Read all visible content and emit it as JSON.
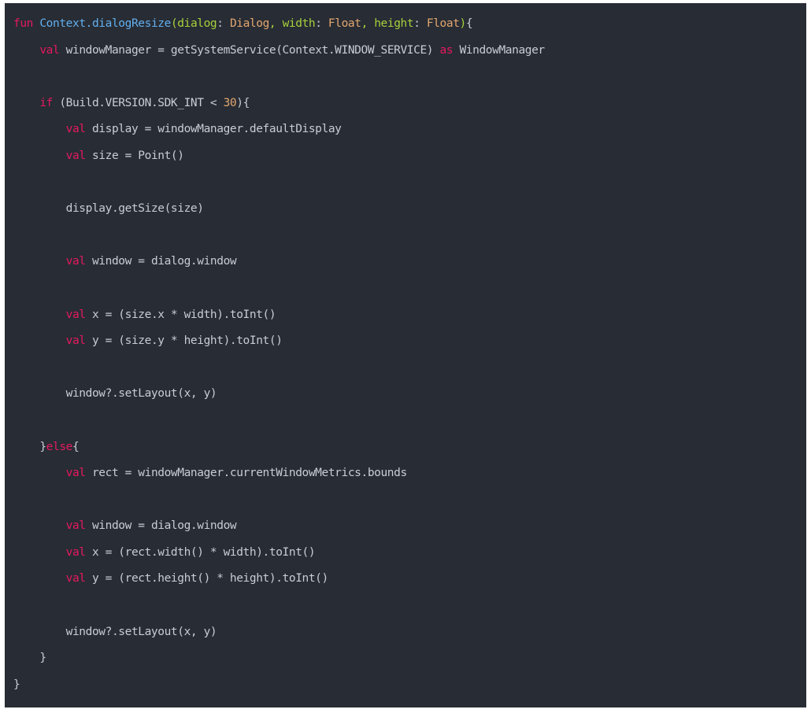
{
  "code": {
    "language": "kotlin",
    "colors": {
      "background": "#282c34",
      "keyword": "#e5195f",
      "function": "#61afef",
      "parameter": "#a6d13c",
      "type": "#e2a76f",
      "number": "#e2a76f",
      "plain": "#c8ccd4"
    },
    "lines": [
      [
        [
          "kw",
          "fun"
        ],
        [
          "plain",
          " "
        ],
        [
          "fn",
          "Context.dialogResize"
        ],
        [
          "param",
          "(dialog"
        ],
        [
          "plain",
          ": "
        ],
        [
          "type",
          "Dialog"
        ],
        [
          "param",
          ", width"
        ],
        [
          "plain",
          ": "
        ],
        [
          "type",
          "Float"
        ],
        [
          "param",
          ", height"
        ],
        [
          "plain",
          ": "
        ],
        [
          "type",
          "Float"
        ],
        [
          "param",
          ")"
        ],
        [
          "plain",
          "{"
        ]
      ],
      [
        [
          "plain",
          "    "
        ],
        [
          "kw",
          "val"
        ],
        [
          "plain",
          " windowManager = getSystemService(Context.WINDOW_SERVICE) "
        ],
        [
          "kw",
          "as"
        ],
        [
          "plain",
          " WindowManager"
        ]
      ],
      [],
      [
        [
          "plain",
          "    "
        ],
        [
          "kw",
          "if"
        ],
        [
          "plain",
          " (Build.VERSION.SDK_INT < "
        ],
        [
          "num",
          "30"
        ],
        [
          "plain",
          "){"
        ]
      ],
      [
        [
          "plain",
          "        "
        ],
        [
          "kw",
          "val"
        ],
        [
          "plain",
          " display = windowManager.defaultDisplay"
        ]
      ],
      [
        [
          "plain",
          "        "
        ],
        [
          "kw",
          "val"
        ],
        [
          "plain",
          " size = Point()"
        ]
      ],
      [],
      [
        [
          "plain",
          "        display.getSize(size)"
        ]
      ],
      [],
      [
        [
          "plain",
          "        "
        ],
        [
          "kw",
          "val"
        ],
        [
          "plain",
          " window = dialog.window"
        ]
      ],
      [],
      [
        [
          "plain",
          "        "
        ],
        [
          "kw",
          "val"
        ],
        [
          "plain",
          " x = (size.x * width).toInt()"
        ]
      ],
      [
        [
          "plain",
          "        "
        ],
        [
          "kw",
          "val"
        ],
        [
          "plain",
          " y = (size.y * height).toInt()"
        ]
      ],
      [],
      [
        [
          "plain",
          "        window?.setLayout(x, y)"
        ]
      ],
      [],
      [
        [
          "plain",
          "    }"
        ],
        [
          "kw",
          "else"
        ],
        [
          "plain",
          "{"
        ]
      ],
      [
        [
          "plain",
          "        "
        ],
        [
          "kw",
          "val"
        ],
        [
          "plain",
          " rect = windowManager.currentWindowMetrics.bounds"
        ]
      ],
      [],
      [
        [
          "plain",
          "        "
        ],
        [
          "kw",
          "val"
        ],
        [
          "plain",
          " window = dialog.window"
        ]
      ],
      [
        [
          "plain",
          "        "
        ],
        [
          "kw",
          "val"
        ],
        [
          "plain",
          " x = (rect.width() * width).toInt()"
        ]
      ],
      [
        [
          "plain",
          "        "
        ],
        [
          "kw",
          "val"
        ],
        [
          "plain",
          " y = (rect.height() * height).toInt()"
        ]
      ],
      [],
      [
        [
          "plain",
          "        window?.setLayout(x, y)"
        ]
      ],
      [
        [
          "plain",
          "    }"
        ]
      ],
      [
        [
          "plain",
          "}"
        ]
      ]
    ]
  }
}
